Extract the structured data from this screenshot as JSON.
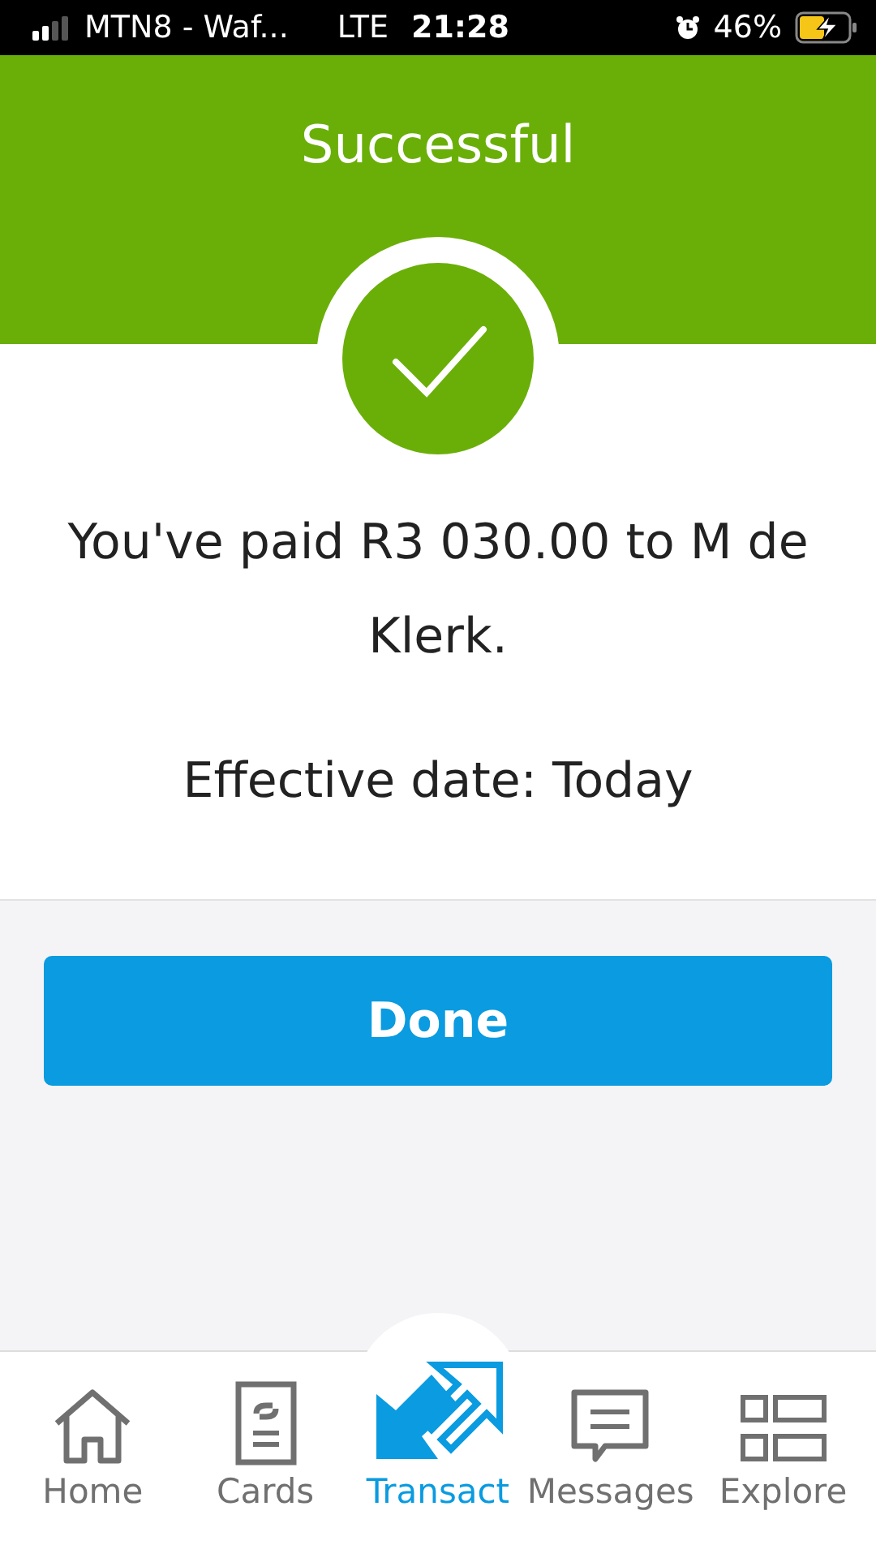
{
  "status_bar": {
    "carrier": "MTN8 - Waf...",
    "network": "LTE",
    "time": "21:28",
    "battery": "46%"
  },
  "header": {
    "title": "Successful"
  },
  "message": {
    "text": "You've paid R3 030.00 to M de Klerk.",
    "effective_date": "Effective date: Today"
  },
  "done_button": "Done",
  "nav": [
    {
      "kind": "home",
      "label": "Home",
      "selected": false
    },
    {
      "kind": "cards",
      "label": "Cards",
      "selected": false
    },
    {
      "kind": "transact",
      "label": "Transact",
      "selected": true
    },
    {
      "kind": "messages",
      "label": "Messages",
      "selected": false
    },
    {
      "kind": "explore",
      "label": "Explore",
      "selected": false
    }
  ]
}
